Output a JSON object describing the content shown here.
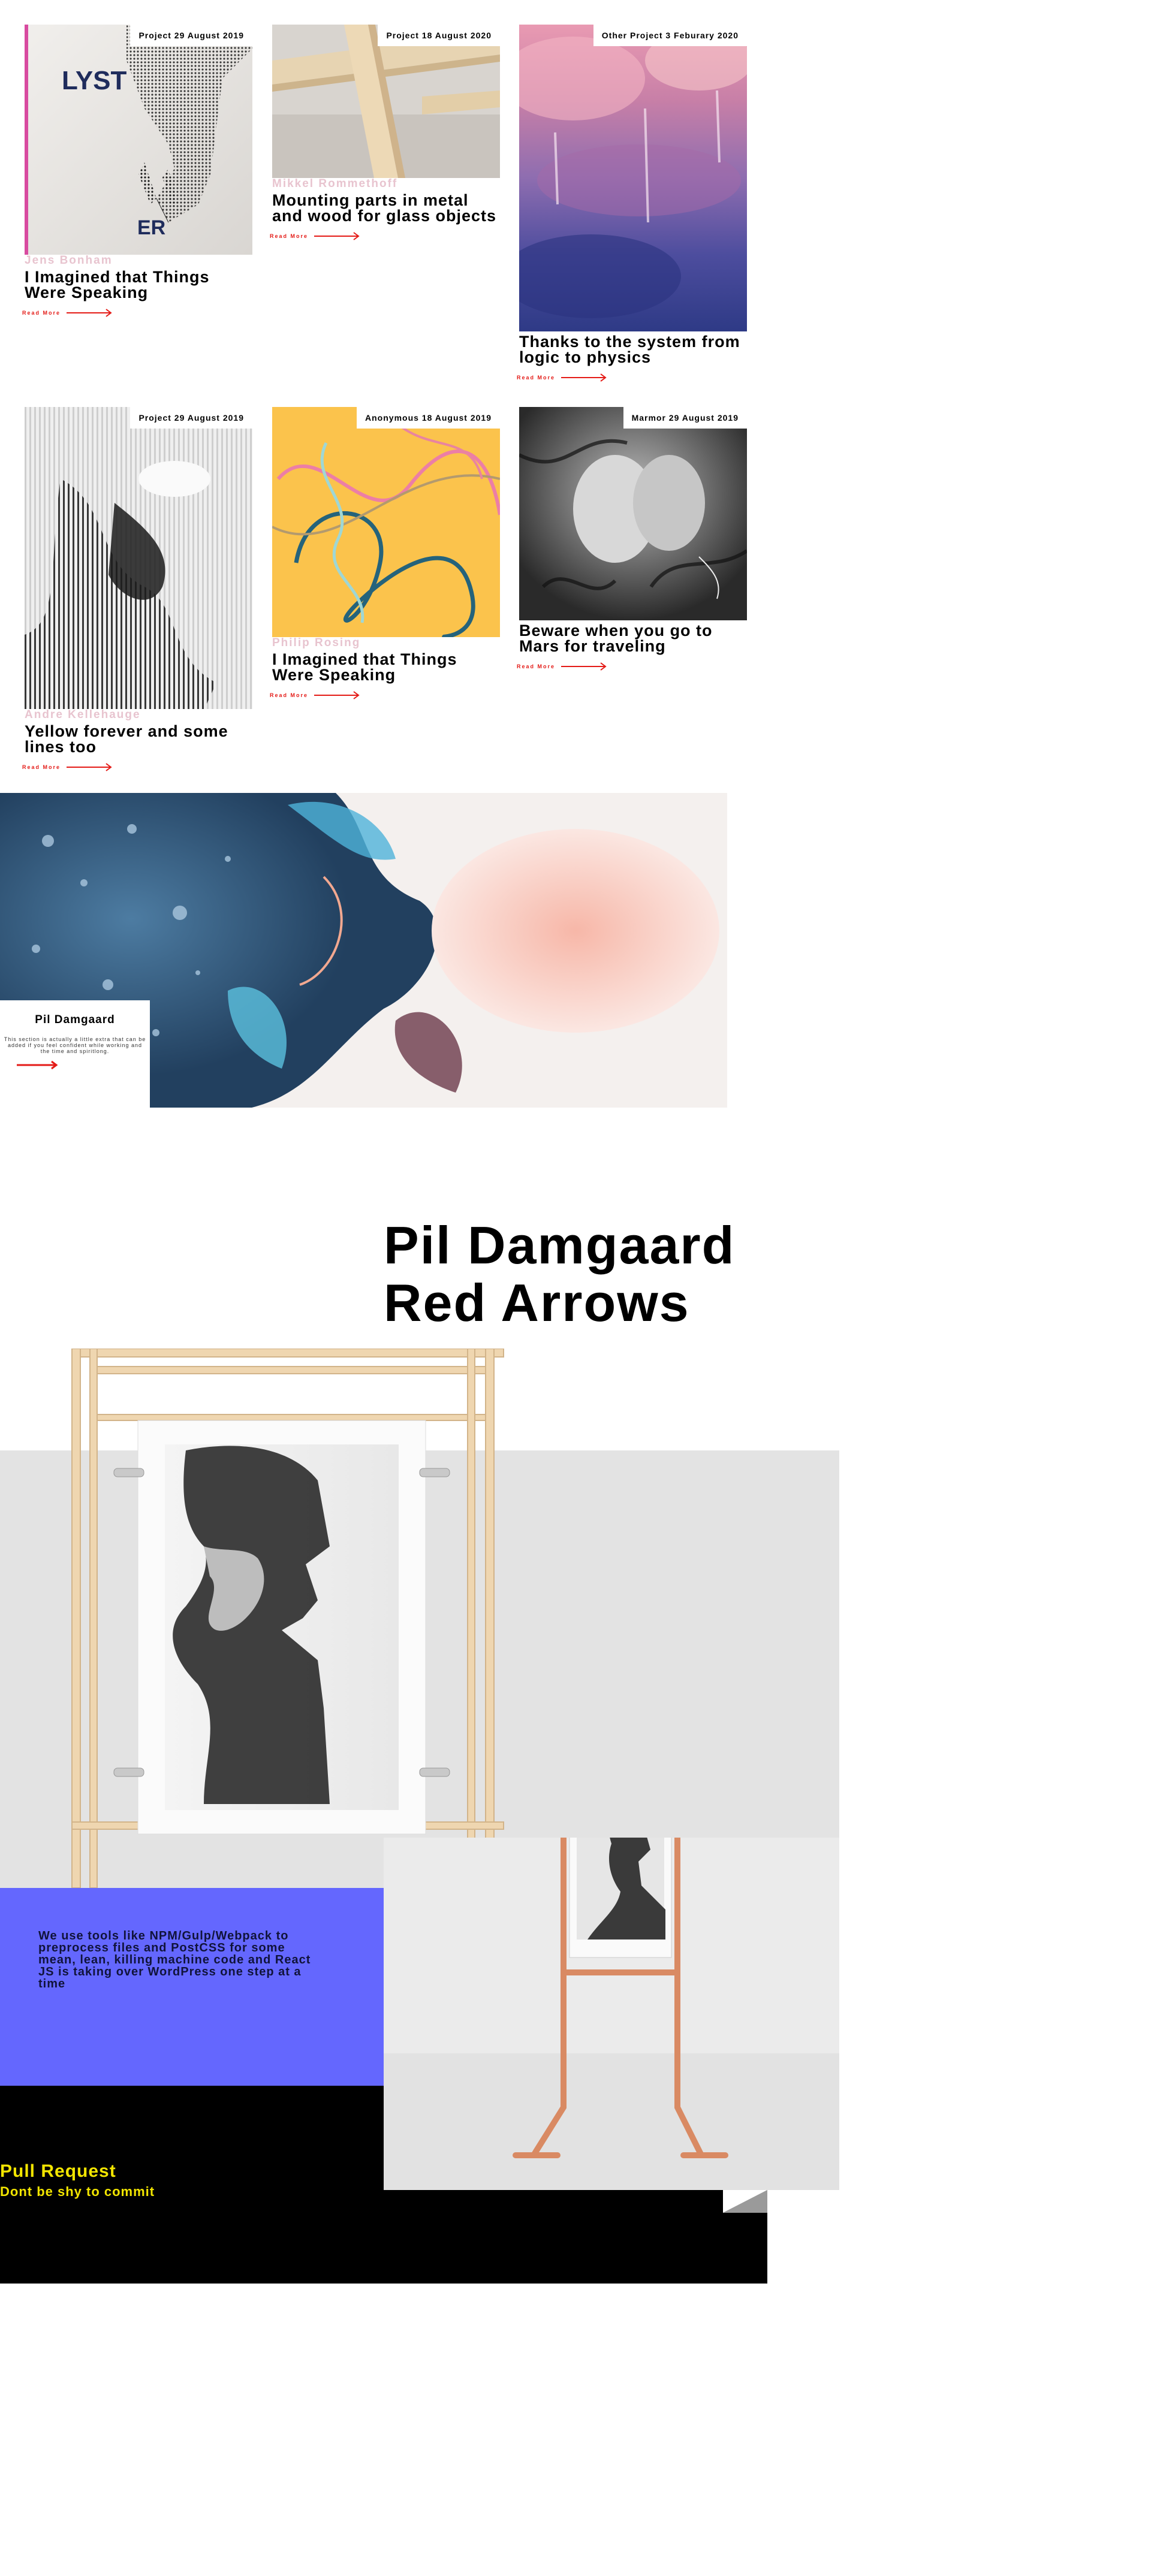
{
  "cards": [
    {
      "badge": "Project 29 August 2019",
      "author": "Jens Bonham",
      "title": "I Imagined that Things Were Speaking",
      "read_more": "Read More",
      "image": "lyst-poster-hand",
      "image_text": {
        "top": "LYST",
        "bottom": "ER"
      }
    },
    {
      "badge": "Project 18 August 2020",
      "author": "Mikkel Rommethoff",
      "title": "Mounting parts in metal and wood for glass objects",
      "read_more": "Read More",
      "image": "wooden-frame-joint"
    },
    {
      "badge": "Other Project 3 Feburary 2020",
      "author": "",
      "title": "Thanks to the system from logic to physics",
      "read_more": "Read More",
      "image": "pink-purple-abstract-painting"
    },
    {
      "badge": "Project 29 August 2019",
      "author": "Andre Kellehauge",
      "title": "Yellow forever and some lines too",
      "read_more": "Read More",
      "image": "black-white-distorted-print"
    },
    {
      "badge": "Anonymous 18 August 2019",
      "author": "Philip Rosing",
      "title": "I Imagined that Things Were Speaking",
      "read_more": "Read More",
      "image": "yellow-lines-drawing"
    },
    {
      "badge": "Marmor 29 August 2019",
      "author": "",
      "title": "Beware when you go to Mars for traveling",
      "read_more": "Read More",
      "image": "marble-stone-photo"
    }
  ],
  "hero": {
    "name": "Pil Damgaard",
    "description": "This section is actually a little extra that can be added if you feel confident while working and the time and spiritlong.",
    "image": "blue-pink-ink-abstract"
  },
  "feature": {
    "title_line1": "Pil Damgaard",
    "title_line2": "Red Arrows",
    "tools_text": "We use tools like NPM/Gulp/Webpack to preprocess files and PostCSS for some mean, lean, killing machine code and React JS is taking over WordPress one step at a time",
    "pr_title": "Pull Request",
    "pr_subtitle": "Dont be shy to commit"
  },
  "colors": {
    "accent_red": "#e41b17",
    "purple": "#6467fe",
    "yellow": "#f2e500",
    "author_pink": "#e8c4cf"
  }
}
